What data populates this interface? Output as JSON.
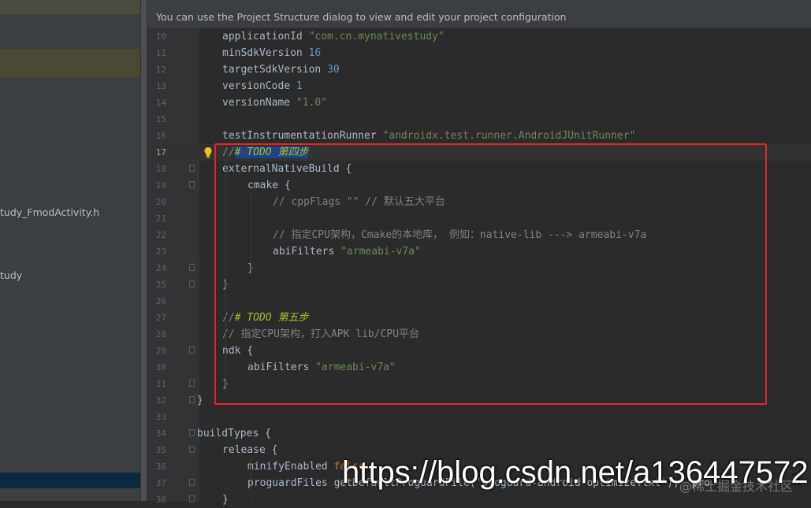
{
  "banner": {
    "text": "You can use the Project Structure dialog to view and edit your project configuration"
  },
  "sidebar": {
    "items": [
      {
        "label": "tudy_FmodActivity.h"
      },
      {
        "label": "tudy"
      }
    ]
  },
  "editor": {
    "current_line": 17,
    "lines": [
      {
        "n": "10",
        "indent": 2,
        "tokens": [
          {
            "t": "applicationId ",
            "c": "plain"
          },
          {
            "t": "\"com.cn.mynativestudy\"",
            "c": "str"
          }
        ]
      },
      {
        "n": "11",
        "indent": 2,
        "tokens": [
          {
            "t": "minSdkVersion ",
            "c": "plain"
          },
          {
            "t": "16",
            "c": "num"
          }
        ]
      },
      {
        "n": "12",
        "indent": 2,
        "tokens": [
          {
            "t": "targetSdkVersion ",
            "c": "plain"
          },
          {
            "t": "30",
            "c": "num"
          }
        ]
      },
      {
        "n": "13",
        "indent": 2,
        "tokens": [
          {
            "t": "versionCode ",
            "c": "plain"
          },
          {
            "t": "1",
            "c": "num"
          }
        ]
      },
      {
        "n": "14",
        "indent": 2,
        "tokens": [
          {
            "t": "versionName ",
            "c": "plain"
          },
          {
            "t": "\"1.0\"",
            "c": "str"
          }
        ]
      },
      {
        "n": "15",
        "indent": 0,
        "tokens": []
      },
      {
        "n": "16",
        "indent": 2,
        "tokens": [
          {
            "t": "testInstrumentationRunner ",
            "c": "plain"
          },
          {
            "t": "\"androidx.test.runner.AndroidJUnitRunner\"",
            "c": "str"
          }
        ]
      },
      {
        "n": "17",
        "indent": 2,
        "tokens": [
          {
            "t": "//",
            "c": "cmt"
          },
          {
            "t": "# TODO 第四步",
            "c": "todo-sel"
          }
        ]
      },
      {
        "n": "18",
        "indent": 2,
        "tokens": [
          {
            "t": "externalNativeBuild {",
            "c": "plain"
          }
        ]
      },
      {
        "n": "19",
        "indent": 3,
        "tokens": [
          {
            "t": "cmake {",
            "c": "plain"
          }
        ]
      },
      {
        "n": "20",
        "indent": 4,
        "tokens": [
          {
            "t": "// cppFlags \"\" // 默认五大平台",
            "c": "cmt"
          }
        ]
      },
      {
        "n": "21",
        "indent": 0,
        "tokens": []
      },
      {
        "n": "22",
        "indent": 4,
        "tokens": [
          {
            "t": "// 指定CPU架构，Cmake的本地库， 例如：native-lib ---> armeabi-v7a",
            "c": "cmt"
          }
        ]
      },
      {
        "n": "23",
        "indent": 4,
        "tokens": [
          {
            "t": "abiFilters ",
            "c": "plain"
          },
          {
            "t": "\"armeabi-v7a\"",
            "c": "str"
          }
        ]
      },
      {
        "n": "24",
        "indent": 3,
        "tokens": [
          {
            "t": "}",
            "c": "plain"
          }
        ]
      },
      {
        "n": "25",
        "indent": 2,
        "tokens": [
          {
            "t": "}",
            "c": "plain"
          }
        ]
      },
      {
        "n": "26",
        "indent": 0,
        "tokens": []
      },
      {
        "n": "27",
        "indent": 2,
        "tokens": [
          {
            "t": "//",
            "c": "cmt"
          },
          {
            "t": "# TODO 第五步",
            "c": "todo"
          }
        ]
      },
      {
        "n": "28",
        "indent": 2,
        "tokens": [
          {
            "t": "// 指定CPU架构，打入APK lib/CPU平台",
            "c": "cmt"
          }
        ]
      },
      {
        "n": "29",
        "indent": 2,
        "tokens": [
          {
            "t": "ndk {",
            "c": "plain"
          }
        ]
      },
      {
        "n": "30",
        "indent": 3,
        "tokens": [
          {
            "t": "abiFilters ",
            "c": "plain"
          },
          {
            "t": "\"armeabi-v7a\"",
            "c": "str"
          }
        ]
      },
      {
        "n": "31",
        "indent": 2,
        "tokens": [
          {
            "t": "}",
            "c": "plain"
          }
        ]
      },
      {
        "n": "32",
        "indent": 1,
        "tokens": [
          {
            "t": "}",
            "c": "plain"
          }
        ]
      },
      {
        "n": "33",
        "indent": 0,
        "tokens": []
      },
      {
        "n": "34",
        "indent": 1,
        "tokens": [
          {
            "t": "buildTypes {",
            "c": "plain"
          }
        ]
      },
      {
        "n": "35",
        "indent": 2,
        "tokens": [
          {
            "t": "release {",
            "c": "plain"
          }
        ]
      },
      {
        "n": "36",
        "indent": 3,
        "tokens": [
          {
            "t": "minifyEnabled ",
            "c": "plain"
          },
          {
            "t": "false",
            "c": "kw"
          }
        ]
      },
      {
        "n": "37",
        "indent": 3,
        "tokens": [
          {
            "t": "proguardFiles getDefaultProguardFile('proguard-android-optimize.txt'), 'pro",
            "c": "plain"
          }
        ]
      },
      {
        "n": "38",
        "indent": 2,
        "tokens": [
          {
            "t": "}",
            "c": "plain"
          }
        ]
      }
    ]
  },
  "colors": {
    "highlight_box": "#e0252d",
    "background": "#2b2b2b",
    "sidebar": "#3c3f41"
  },
  "icons": {
    "intention": "lightbulb-icon",
    "fold": "fold-marker-icon"
  },
  "watermark": {
    "text": "https://blog.csdn.net/a136447572",
    "secondary": "@稀土掘金技术社区"
  }
}
